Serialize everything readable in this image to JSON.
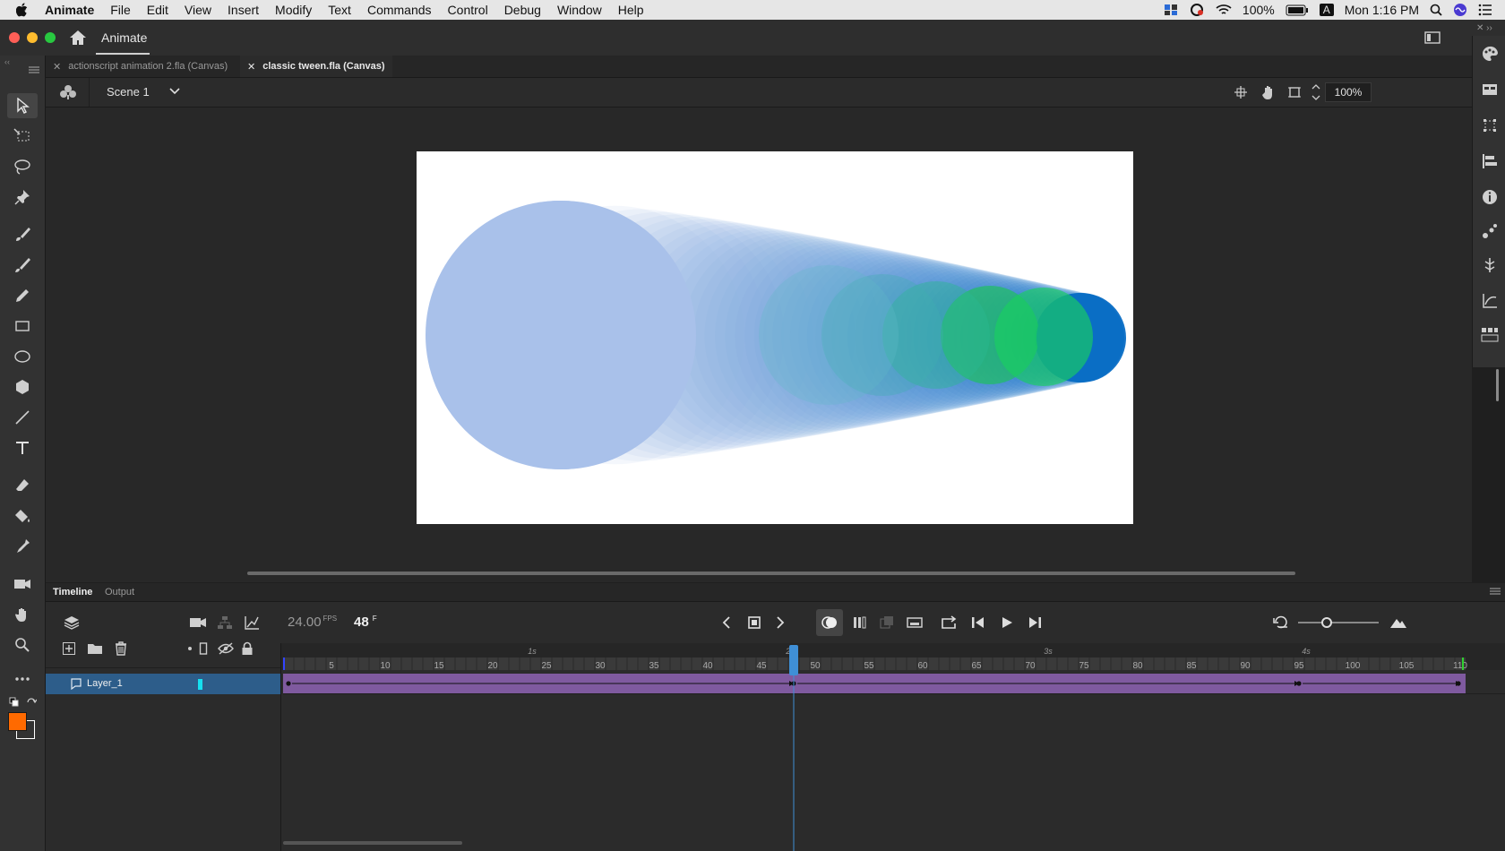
{
  "menubar": {
    "apple": "",
    "items": [
      "Animate",
      "File",
      "Edit",
      "View",
      "Insert",
      "Modify",
      "Text",
      "Commands",
      "Control",
      "Debug",
      "Window",
      "Help"
    ],
    "battery": "100%",
    "keyboard": "A",
    "clock": "Mon 1:16 PM"
  },
  "titlebar": {
    "app_title": "Animate"
  },
  "tabs": [
    {
      "label": "actionscript animation 2.fla (Canvas)"
    },
    {
      "label": "classic tween.fla (Canvas)"
    }
  ],
  "editbar": {
    "scene": "Scene 1",
    "zoom": "100%"
  },
  "timeline": {
    "tabs": [
      "Timeline",
      "Output"
    ],
    "fps": "24.00",
    "fps_unit": "FPS",
    "frame": "48",
    "frame_unit": "F",
    "time_markers": [
      "1s",
      "2s",
      "3s",
      "4s"
    ],
    "frame_numbers": [
      "5",
      "10",
      "15",
      "20",
      "25",
      "30",
      "35",
      "40",
      "45",
      "50",
      "55",
      "60",
      "65",
      "70",
      "75",
      "80",
      "85",
      "90",
      "95",
      "100",
      "105",
      "110"
    ],
    "playhead_frame": 48,
    "total_frames": 110,
    "keyframes": [
      1,
      48,
      95,
      110
    ],
    "layers": [
      {
        "name": "Layer_1"
      }
    ]
  },
  "colors": {
    "tween_purple": "#7f5a9f",
    "layer_selected": "#2d5d8a",
    "playhead": "#3f8fd6",
    "fill_color": "#ff6a00",
    "stroke_color": "#ffffff",
    "circle_start": "#a9c1ea",
    "circle_end": "#0b6ec5"
  }
}
